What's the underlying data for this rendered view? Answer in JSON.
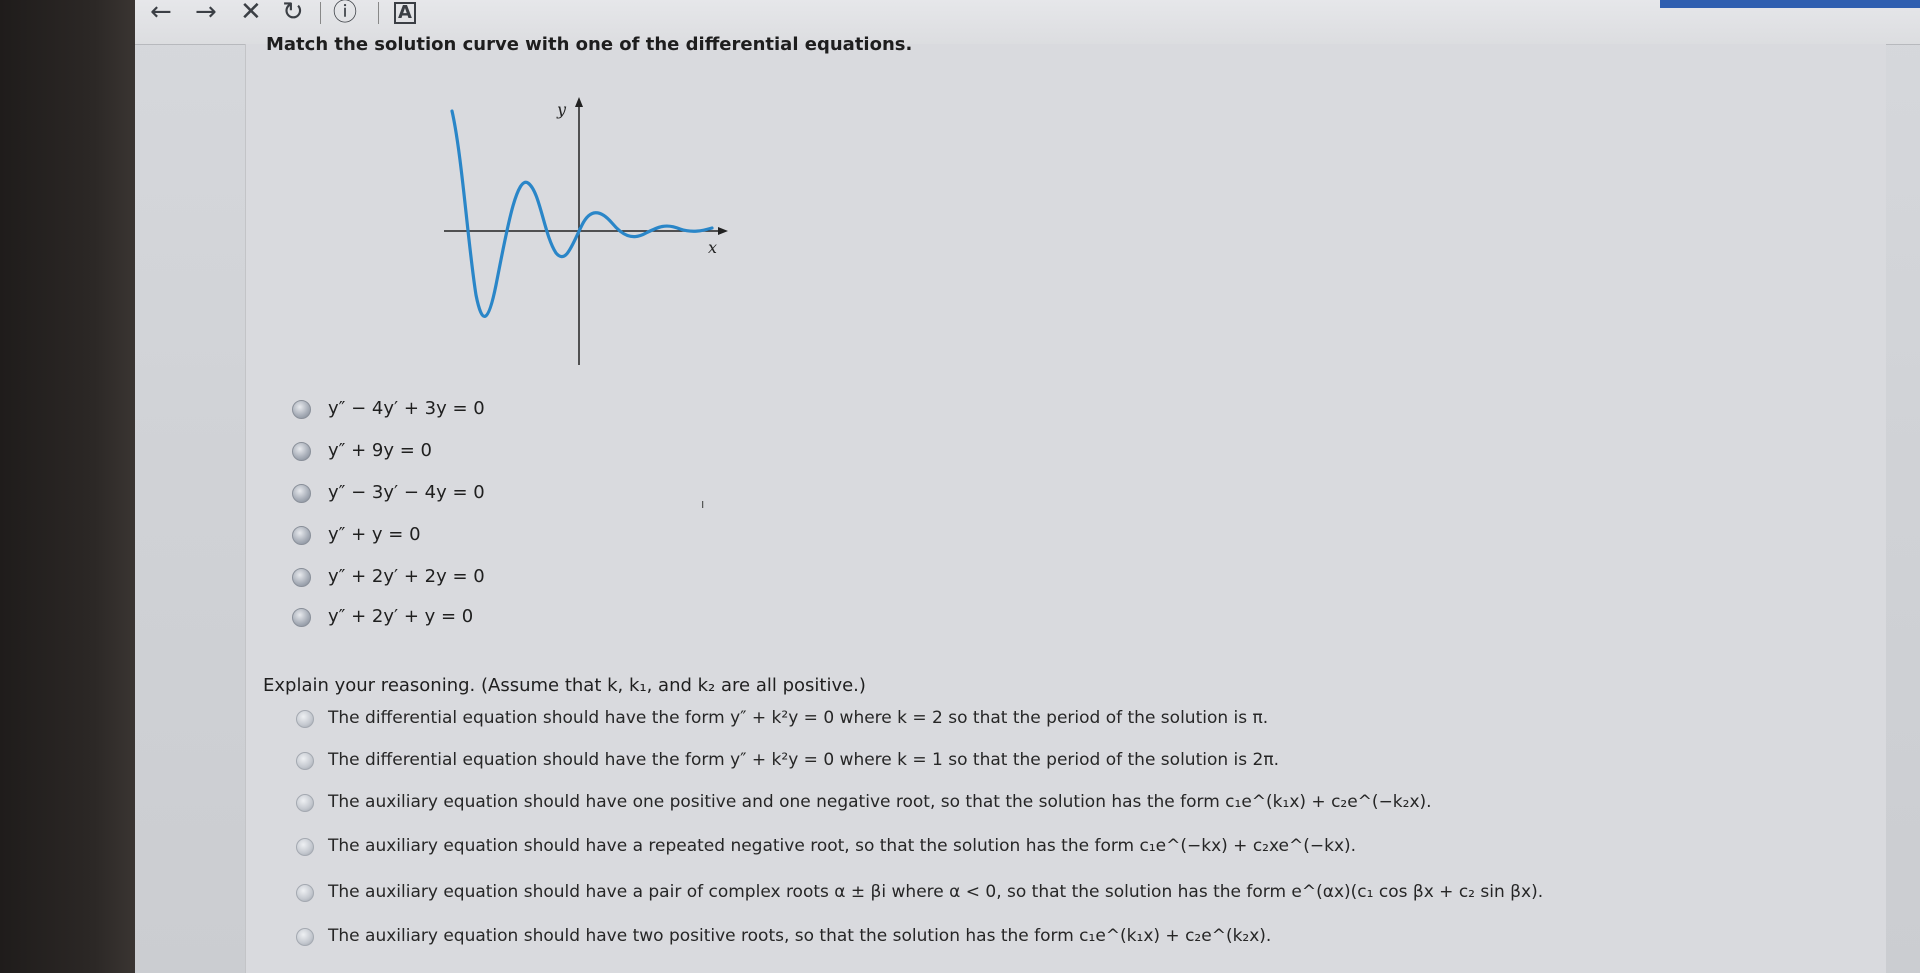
{
  "toolbar": {
    "back_icon": "←",
    "forward_icon": "→",
    "stop_icon": "✕",
    "reload_icon": "↻",
    "info_icon": "ⓘ",
    "reader_icon": "A"
  },
  "question": {
    "prompt": "Match the solution curve with one of the differential equations."
  },
  "graph": {
    "y_label": "y",
    "x_label": "x",
    "curve_color": "#2a86c8",
    "description_type": "damped oscillation decaying to the right"
  },
  "options": [
    {
      "label": "y″ − 4y′ + 3y = 0"
    },
    {
      "label": "y″ + 9y = 0"
    },
    {
      "label": "y″ − 3y′ − 4y = 0"
    },
    {
      "label": "y″ + y = 0"
    },
    {
      "label": "y″ + 2y′ + 2y = 0"
    },
    {
      "label": "y″ + 2y′ + y = 0"
    }
  ],
  "explain": {
    "prompt": "Explain your reasoning. (Assume that k, k₁, and k₂ are all positive.)"
  },
  "reasons": [
    {
      "label": "The differential equation should have the form y″ + k²y = 0 where k = 2 so that the period of the solution is π."
    },
    {
      "label": "The differential equation should have the form y″ + k²y = 0 where k = 1 so that the period of the solution is 2π."
    },
    {
      "label": "The auxiliary equation should have one positive and one negative root, so that the solution has the form c₁e^(k₁x) + c₂e^(−k₂x)."
    },
    {
      "label": "The auxiliary equation should have a repeated negative root, so that the solution has the form c₁e^(−kx) + c₂xe^(−kx)."
    },
    {
      "label": "The auxiliary equation should have a pair of complex roots α ± βi where α < 0, so that the solution has the form e^(αx)(c₁ cos βx + c₂ sin βx)."
    },
    {
      "label": "The auxiliary equation should have two positive roots, so that the solution has the form c₁e^(k₁x) + c₂e^(k₂x)."
    }
  ]
}
